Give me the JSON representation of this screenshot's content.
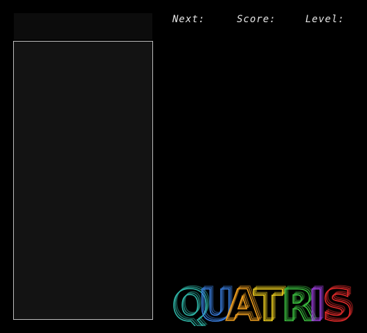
{
  "hud": {
    "next_label": "Next:",
    "score_label": "Score:",
    "level_label": "Level:"
  },
  "logo": {
    "letters": [
      {
        "char": "Q",
        "color": "#2fb7a8"
      },
      {
        "char": "U",
        "color": "#3a7fe0"
      },
      {
        "char": "A",
        "color": "#f0a020"
      },
      {
        "char": "T",
        "color": "#f0d020"
      },
      {
        "char": "R",
        "color": "#3cc040"
      },
      {
        "char": "I",
        "color": "#a040e0"
      },
      {
        "char": "S",
        "color": "#e02a2a"
      }
    ]
  },
  "colors": {
    "background": "#000000",
    "board": "#131313",
    "board_border": "#bfbfbf",
    "text": "#e6e6e6"
  }
}
